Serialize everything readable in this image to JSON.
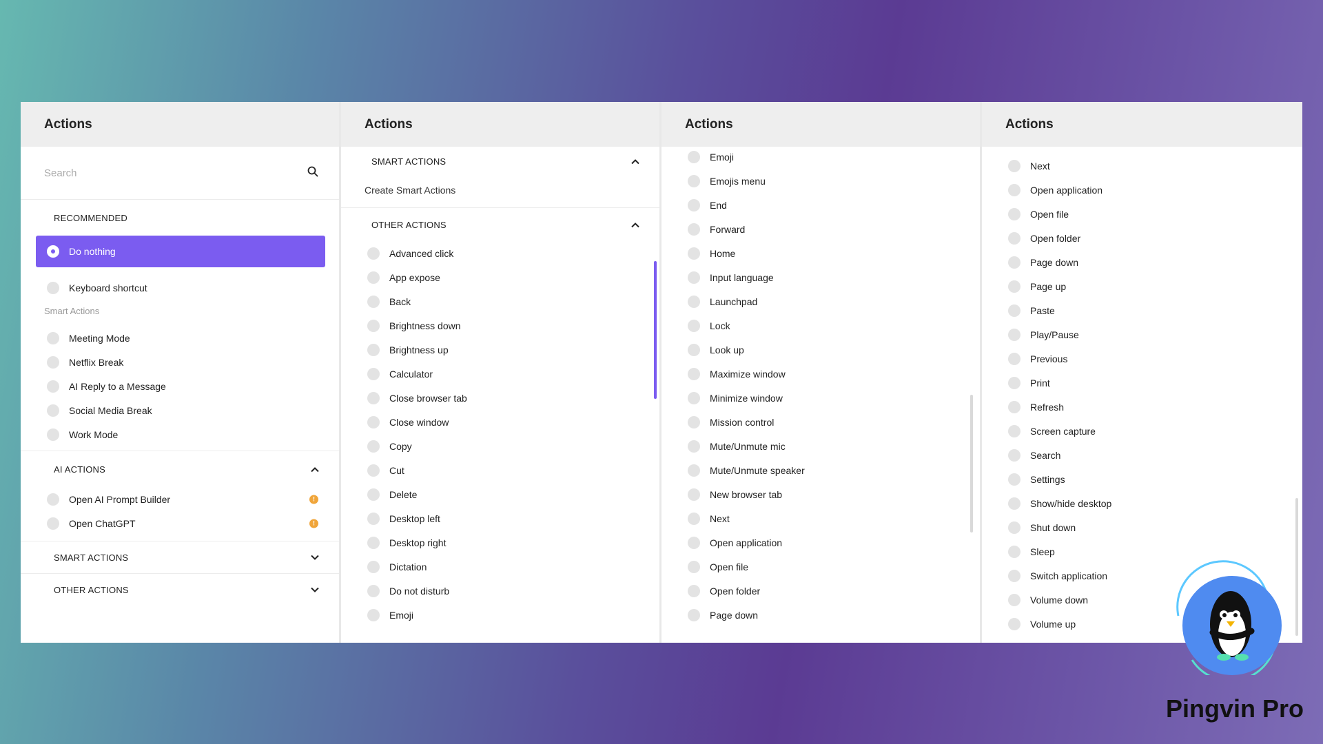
{
  "colors": {
    "accent": "#7b5cf0",
    "warning": "#f0a53a",
    "header_bg": "#eeeeee"
  },
  "panel1": {
    "title": "Actions",
    "search_placeholder": "Search",
    "recommended_label": "RECOMMENDED",
    "recommended": [
      "Do nothing",
      "Keyboard shortcut"
    ],
    "smart_actions_sub": "Smart Actions",
    "smart": [
      "Meeting Mode",
      "Netflix Break",
      "AI Reply to a Message",
      "Social Media Break",
      "Work Mode"
    ],
    "ai_actions_label": "AI ACTIONS",
    "ai": [
      "Open AI Prompt Builder",
      "Open ChatGPT"
    ],
    "smart_actions_label": "SMART ACTIONS",
    "other_actions_label": "OTHER ACTIONS"
  },
  "panel2": {
    "title": "Actions",
    "smart_actions_label": "SMART ACTIONS",
    "create_smart": "Create Smart Actions",
    "other_actions_label": "OTHER ACTIONS",
    "items": [
      "Advanced click",
      "App expose",
      "Back",
      "Brightness down",
      "Brightness up",
      "Calculator",
      "Close browser tab",
      "Close window",
      "Copy",
      "Cut",
      "Delete",
      "Desktop left",
      "Desktop right",
      "Dictation",
      "Do not disturb",
      "Emoji"
    ]
  },
  "panel3": {
    "title": "Actions",
    "items": [
      "Emoji",
      "Emojis menu",
      "End",
      "Forward",
      "Home",
      "Input language",
      "Launchpad",
      "Lock",
      "Look up",
      "Maximize window",
      "Minimize window",
      "Mission control",
      "Mute/Unmute mic",
      "Mute/Unmute speaker",
      "New browser tab",
      "Next",
      "Open application",
      "Open file",
      "Open folder",
      "Page down"
    ]
  },
  "panel4": {
    "title": "Actions",
    "items": [
      "Next",
      "Open application",
      "Open file",
      "Open folder",
      "Page down",
      "Page up",
      "Paste",
      "Play/Pause",
      "Previous",
      "Print",
      "Refresh",
      "Screen capture",
      "Search",
      "Settings",
      "Show/hide desktop",
      "Shut down",
      "Sleep",
      "Switch application",
      "Volume down",
      "Volume up"
    ]
  },
  "watermark": {
    "text": "Pingvin Pro",
    "icon": "penguin-logo-icon"
  }
}
